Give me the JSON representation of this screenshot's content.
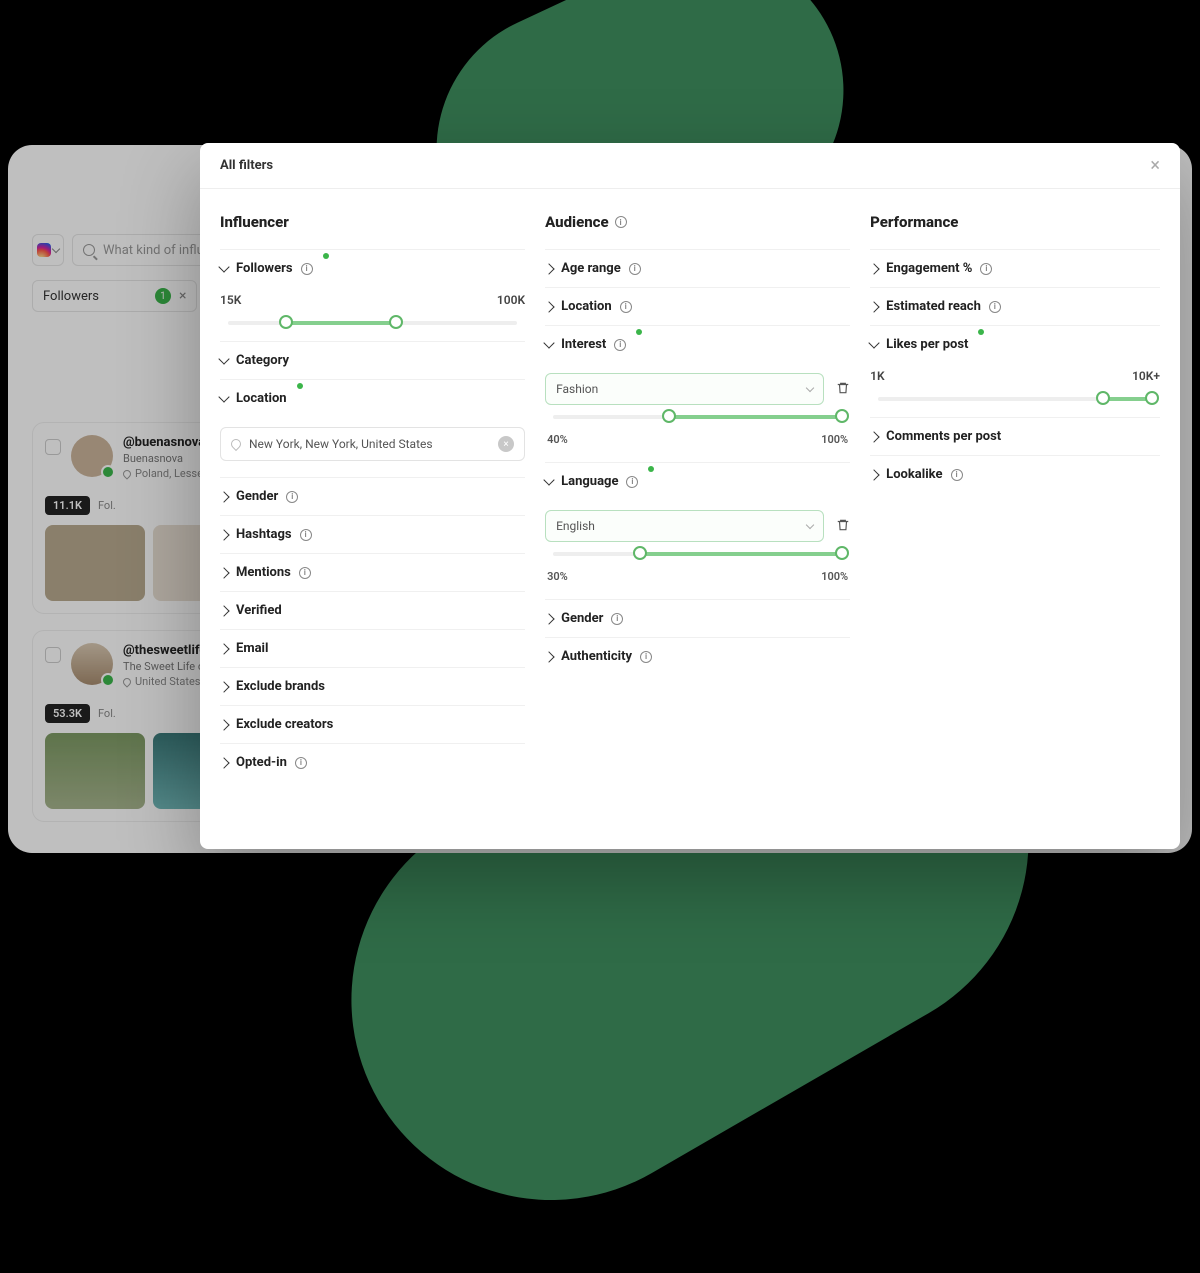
{
  "bg": {
    "search_placeholder": "What kind of influencer...",
    "followers_chip": "Followers",
    "followers_count": "1",
    "card1": {
      "handle": "@buenasnova",
      "name": "Buenasnova",
      "location": "Poland, Lesser...",
      "followers": "11.1K",
      "fol_label": "Fol."
    },
    "card2": {
      "handle": "@thesweetlife...",
      "name": "The Sweet Life of...",
      "location": "United States",
      "followers": "53.3K",
      "fol_label": "Fol."
    }
  },
  "modal": {
    "title": "All filters",
    "sections": {
      "influencer": "Influencer",
      "audience": "Audience",
      "performance": "Performance"
    },
    "influencer": {
      "followers": {
        "label": "Followers",
        "min": "15K",
        "max": "100K"
      },
      "category": "Category",
      "location": {
        "label": "Location",
        "value": "New York, New York, United States"
      },
      "gender": "Gender",
      "hashtags": "Hashtags",
      "mentions": "Mentions",
      "verified": "Verified",
      "email": "Email",
      "exclude_brands": "Exclude brands",
      "exclude_creators": "Exclude creators",
      "opted_in": "Opted-in"
    },
    "audience": {
      "age_range": "Age range",
      "location": "Location",
      "interest": {
        "label": "Interest",
        "value": "Fashion",
        "min": "40%",
        "max": "100%"
      },
      "language": {
        "label": "Language",
        "value": "English",
        "min": "30%",
        "max": "100%"
      },
      "gender": "Gender",
      "authenticity": "Authenticity"
    },
    "performance": {
      "engagement": "Engagement %",
      "reach": "Estimated reach",
      "likes": {
        "label": "Likes per post",
        "min": "1K",
        "max": "10K+"
      },
      "comments": "Comments per post",
      "lookalike": "Lookalike"
    }
  }
}
